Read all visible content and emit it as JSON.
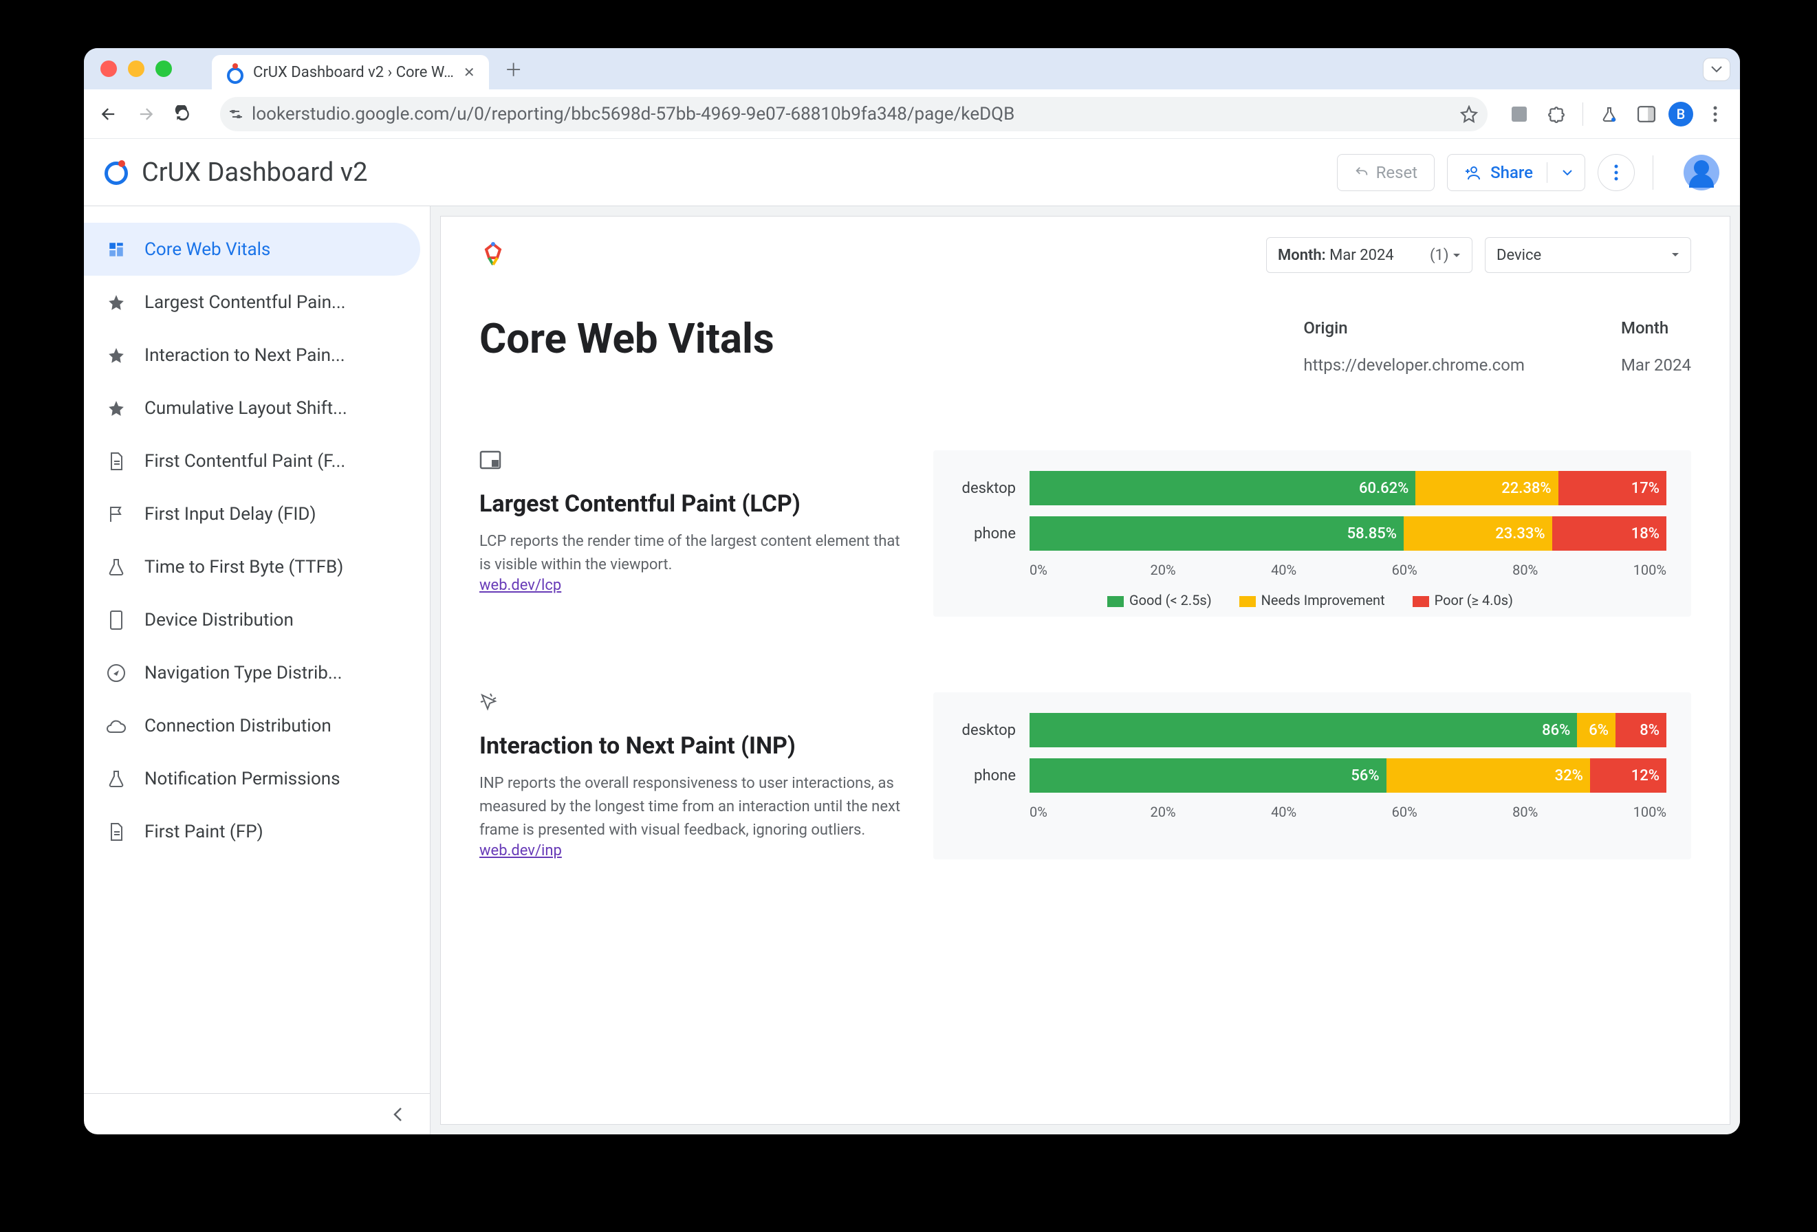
{
  "browser": {
    "tab_title": "CrUX Dashboard v2 › Core W…",
    "url_host": "lookerstudio.google.com",
    "url_path": "/u/0/reporting/bbc5698d-57bb-4969-9e07-68810b9fa348/page/keDQB",
    "profile_initial": "B"
  },
  "app": {
    "title": "CrUX Dashboard v2",
    "reset_label": "Reset",
    "share_label": "Share"
  },
  "filters": {
    "month": {
      "key": "Month:",
      "value": "Mar 2024",
      "count": "(1)"
    },
    "device": {
      "label": "Device"
    }
  },
  "page": {
    "title": "Core Web Vitals",
    "origin_label": "Origin",
    "origin_value": "https://developer.chrome.com",
    "month_label": "Month",
    "month_value": "Mar 2024"
  },
  "sidebar": {
    "items": [
      {
        "label": "Core Web Vitals",
        "icon": "dashboard",
        "active": true
      },
      {
        "label": "Largest Contentful Pain...",
        "icon": "star"
      },
      {
        "label": "Interaction to Next Pain...",
        "icon": "star"
      },
      {
        "label": "Cumulative Layout Shift...",
        "icon": "star"
      },
      {
        "label": "First Contentful Paint (F...",
        "icon": "doc"
      },
      {
        "label": "First Input Delay (FID)",
        "icon": "flag"
      },
      {
        "label": "Time to First Byte (TTFB)",
        "icon": "flask"
      },
      {
        "label": "Device Distribution",
        "icon": "device"
      },
      {
        "label": "Navigation Type Distrib...",
        "icon": "compass"
      },
      {
        "label": "Connection Distribution",
        "icon": "cloud"
      },
      {
        "label": "Notification Permissions",
        "icon": "flask"
      },
      {
        "label": "First Paint (FP)",
        "icon": "doc"
      }
    ]
  },
  "colors": {
    "good": "#34a853",
    "ni": "#fbbc04",
    "poor": "#ea4335"
  },
  "chart_data": [
    {
      "type": "bar",
      "title": "Largest Contentful Paint (LCP)",
      "icon": "viewport",
      "desc": "LCP reports the render time of the largest content element that is visible within the viewport.",
      "link": "web.dev/lcp",
      "categories": [
        "desktop",
        "phone"
      ],
      "series": [
        {
          "name": "Good (< 2.5s)",
          "values": [
            60.62,
            58.85
          ]
        },
        {
          "name": "Needs Improvement",
          "values": [
            22.38,
            23.33
          ]
        },
        {
          "name": "Poor (≥ 4.0s)",
          "values": [
            17,
            18
          ]
        }
      ],
      "xlabel": "",
      "ylabel": "",
      "xlim": [
        0,
        100
      ],
      "ticks": [
        "0%",
        "20%",
        "40%",
        "60%",
        "80%",
        "100%"
      ]
    },
    {
      "type": "bar",
      "title": "Interaction to Next Paint (INP)",
      "icon": "cursor",
      "desc": "INP reports the overall responsiveness to user interactions, as measured by the longest time from an interaction until the next frame is presented with visual feedback, ignoring outliers.",
      "link": "web.dev/inp",
      "categories": [
        "desktop",
        "phone"
      ],
      "series": [
        {
          "name": "Good",
          "values": [
            86,
            56
          ]
        },
        {
          "name": "Needs Improvement",
          "values": [
            6,
            32
          ]
        },
        {
          "name": "Poor",
          "values": [
            8,
            12
          ]
        }
      ],
      "xlabel": "",
      "ylabel": "",
      "xlim": [
        0,
        100
      ],
      "ticks": [
        "0%",
        "20%",
        "40%",
        "60%",
        "80%",
        "100%"
      ],
      "hide_legend": true
    }
  ]
}
